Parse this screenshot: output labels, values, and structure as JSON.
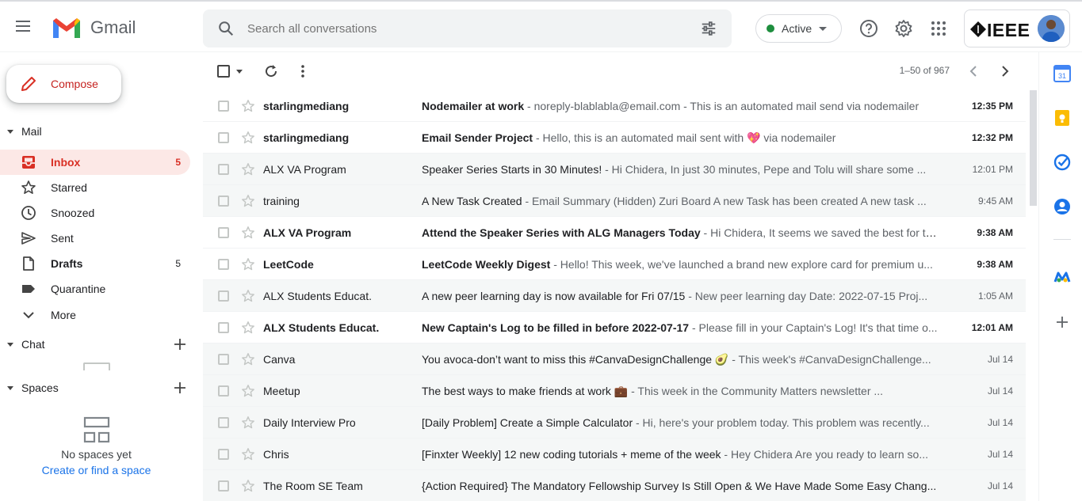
{
  "app": {
    "name": "Gmail"
  },
  "search": {
    "placeholder": "Search all conversations"
  },
  "status": {
    "label": "Active"
  },
  "account": {
    "brand": "IEEE"
  },
  "compose": {
    "label": "Compose"
  },
  "sections": {
    "mail": "Mail",
    "chat": "Chat",
    "spaces": "Spaces"
  },
  "nav": [
    {
      "label": "Inbox",
      "count": "5",
      "icon": "inbox-icon"
    },
    {
      "label": "Starred",
      "count": "",
      "icon": "star-icon"
    },
    {
      "label": "Snoozed",
      "count": "",
      "icon": "clock-icon"
    },
    {
      "label": "Sent",
      "count": "",
      "icon": "send-icon"
    },
    {
      "label": "Drafts",
      "count": "5",
      "icon": "draft-icon"
    },
    {
      "label": "Quarantine",
      "count": "",
      "icon": "label-icon"
    },
    {
      "label": "More",
      "count": "",
      "icon": "chevron-down-icon"
    }
  ],
  "spaces_empty": {
    "text": "No spaces yet",
    "link": "Create or find a space"
  },
  "pager": {
    "text": "1–50 of 967"
  },
  "emails": [
    {
      "sender": "starlingmediang",
      "subject": "Nodemailer at work",
      "snippet": " - noreply-blablabla@email.com - This is an automated mail send via nodemailer",
      "date": "12:35 PM",
      "unread": true
    },
    {
      "sender": "starlingmediang",
      "subject": "Email Sender Project",
      "snippet": " - Hello, this is an automated mail sent with 💖 via nodemailer",
      "date": "12:32 PM",
      "unread": true
    },
    {
      "sender": "ALX VA Program",
      "subject": "Speaker Series Starts in 30 Minutes!",
      "snippet": " - Hi Chidera, In just 30 minutes, Pepe and Tolu will share some ...",
      "date": "12:01 PM",
      "unread": false
    },
    {
      "sender": "training",
      "subject": "A New Task Created",
      "snippet": " - Email Summary (Hidden) Zuri Board A new Task has been created A new task ...",
      "date": "9:45 AM",
      "unread": false
    },
    {
      "sender": "ALX VA Program",
      "subject": "Attend the Speaker Series with ALG Managers Today",
      "snippet": " - Hi Chidera, It seems we saved the best for th...",
      "date": "9:38 AM",
      "unread": true
    },
    {
      "sender": "LeetCode",
      "subject": "LeetCode Weekly Digest",
      "snippet": " - Hello! This week, we've launched a brand new explore card for premium u...",
      "date": "9:38 AM",
      "unread": true
    },
    {
      "sender": "ALX Students Educat.",
      "subject": "A new peer learning day is now available for Fri 07/15",
      "snippet": " - New peer learning day Date: 2022-07-15 Proj...",
      "date": "1:05 AM",
      "unread": false
    },
    {
      "sender": "ALX Students Educat.",
      "subject": "New Captain's Log to be filled in before 2022-07-17",
      "snippet": " - Please fill in your Captain's Log! It's that time o...",
      "date": "12:01 AM",
      "unread": true
    },
    {
      "sender": "Canva",
      "subject": "You avoca-don’t want to miss this #CanvaDesignChallenge 🥑",
      "snippet": " - This week's #CanvaDesignChallenge...",
      "date": "Jul 14",
      "unread": false
    },
    {
      "sender": "Meetup",
      "subject": "The best ways to make friends at work 💼",
      "snippet": " - This week in the Community Matters newsletter ...",
      "date": "Jul 14",
      "unread": false
    },
    {
      "sender": "Daily Interview Pro",
      "subject": "[Daily Problem] Create a Simple Calculator",
      "snippet": " - Hi, here's your problem today. This problem was recently...",
      "date": "Jul 14",
      "unread": false
    },
    {
      "sender": "Chris",
      "subject": "[Finxter Weekly] 12 new coding tutorials + meme of the week",
      "snippet": " - Hey Chidera Are you ready to learn so...",
      "date": "Jul 14",
      "unread": false
    },
    {
      "sender": "The Room SE Team",
      "subject": "{Action Required} The Mandatory Fellowship Survey Is Still Open & We Have Made Some Easy Chang...",
      "snippet": "",
      "date": "Jul 14",
      "unread": false
    }
  ],
  "colors": {
    "accent_red": "#d93025",
    "active_green": "#1e8e3e",
    "link_blue": "#1a73e8"
  }
}
